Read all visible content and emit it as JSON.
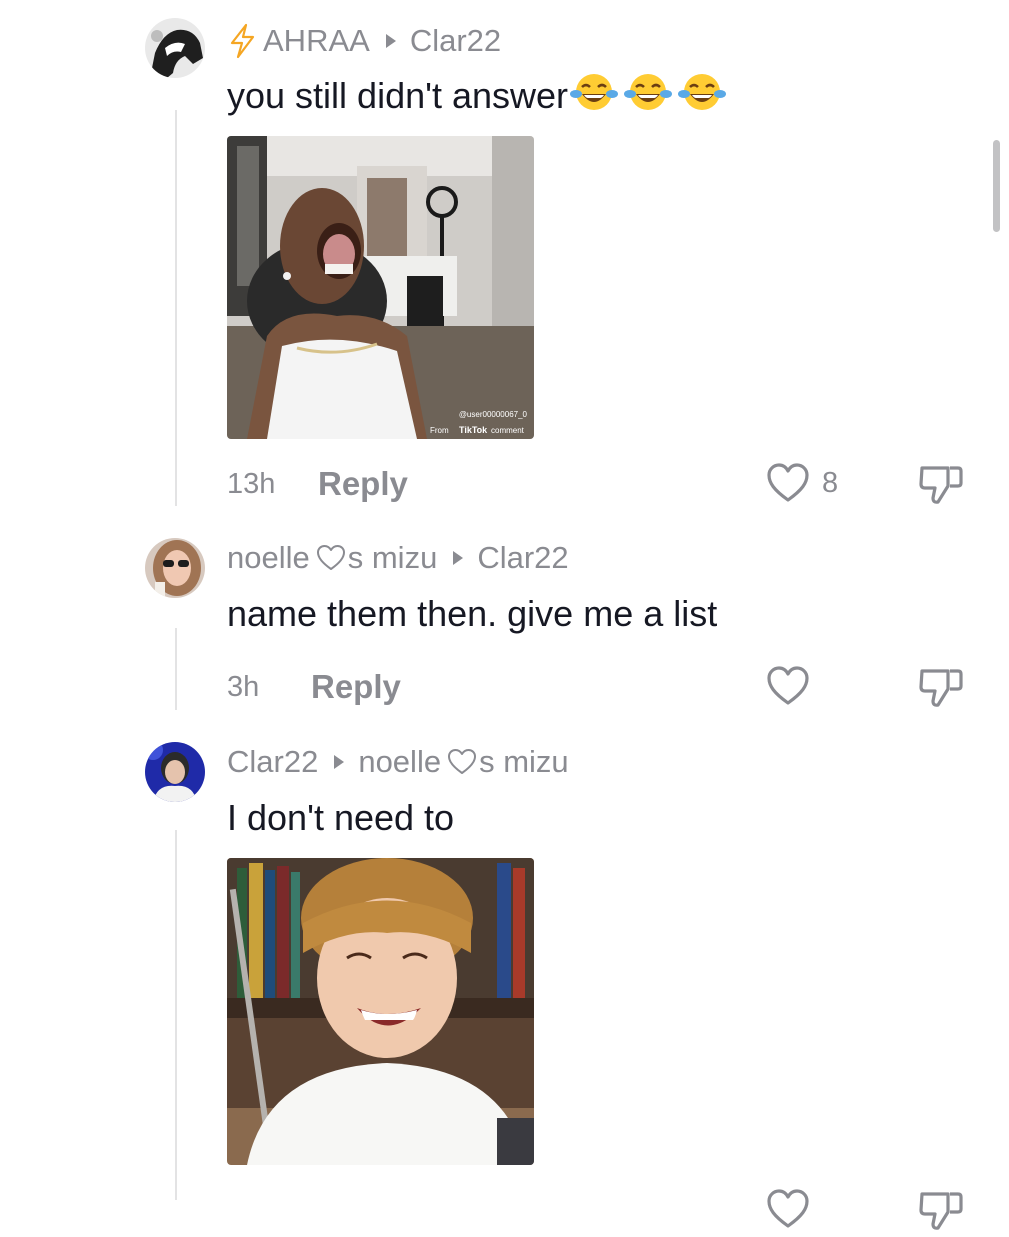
{
  "comments": [
    {
      "author": "AHRAA",
      "author_badge": "lightning-icon",
      "reply_to": "Clar22",
      "text": "you still didn't answer",
      "emoji": "face-with-tears-of-joy x3",
      "media": {
        "watermark_user": "@user00000067_0",
        "watermark_from": "From",
        "watermark_brand": "TikTok",
        "watermark_suffix": "comment"
      },
      "time": "13h",
      "reply_label": "Reply",
      "like_count": "8"
    },
    {
      "author_prefix": "noelle",
      "author_suffix": "s mizu",
      "reply_to": "Clar22",
      "text": "name them then. give me a list",
      "time": "3h",
      "reply_label": "Reply"
    },
    {
      "author": "Clar22",
      "reply_to_prefix": "noelle",
      "reply_to_suffix": "s mizu",
      "text": "I don't need to"
    }
  ],
  "colors": {
    "muted": "#8a8b91",
    "text": "#161823",
    "thread_line": "#e3e3e4",
    "badge": "#f5a623"
  }
}
